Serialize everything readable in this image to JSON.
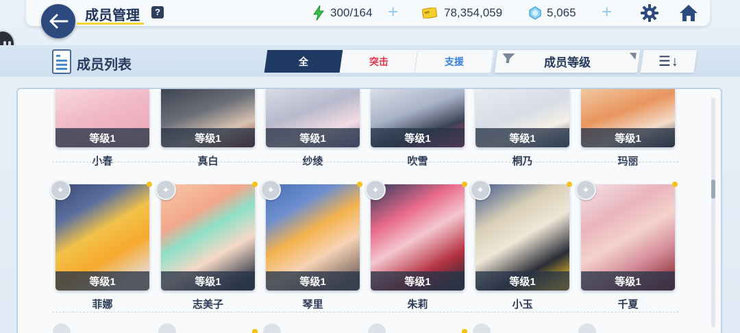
{
  "header": {
    "title": "成员管理",
    "help": "?",
    "stamina": "300/164",
    "credits": "78,354,059",
    "gems": "5,065",
    "faded_overlay": "..."
  },
  "list_header": {
    "title": "成员列表",
    "filters": [
      "全",
      "突击",
      "支援"
    ],
    "sort_label": "成员等级",
    "order_icon": "☰↓"
  },
  "rows": [
    {
      "cards": [
        {
          "name": "小春",
          "level": "等级1"
        },
        {
          "name": "真白",
          "level": "等级1"
        },
        {
          "name": "纱绫",
          "level": "等级1"
        },
        {
          "name": "吹雪",
          "level": "等级1"
        },
        {
          "name": "桐乃",
          "level": "等级1"
        },
        {
          "name": "玛丽",
          "level": "等级1"
        }
      ]
    },
    {
      "cards": [
        {
          "name": "菲娜",
          "level": "等级1"
        },
        {
          "name": "志美子",
          "level": "等级1"
        },
        {
          "name": "琴里",
          "level": "等级1"
        },
        {
          "name": "朱莉",
          "level": "等级1"
        },
        {
          "name": "小玉",
          "level": "等级1"
        },
        {
          "name": "千夏",
          "level": "等级1"
        }
      ]
    }
  ],
  "colors": {
    "accent_dark": "#1f3a63",
    "strike": "#e0364a",
    "support": "#3b82d6",
    "highlight": "#f2d43a"
  },
  "icons": {
    "back": "arrow-left-icon",
    "stamina": "lightning-icon",
    "credits": "credit-card-icon",
    "gems": "gem-icon",
    "settings": "gear-icon",
    "home": "home-icon",
    "pin": "pin-icon"
  }
}
